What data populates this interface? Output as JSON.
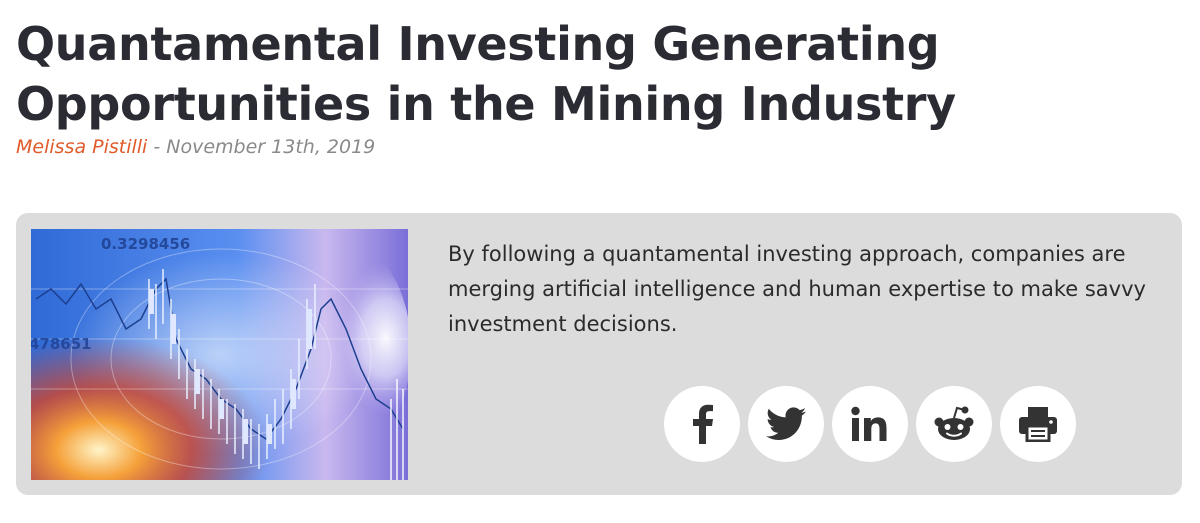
{
  "article": {
    "title_line1": "Quantamental Investing Generating",
    "title_line2": "Opportunities in the Mining Industry",
    "author": "Melissa Pistilli",
    "separator": " - ",
    "date": "November 13th, 2019",
    "summary": "By following a quantamental investing approach, companies are merging artificial intelligence and human expertise to make savvy investment decisions.",
    "image": {
      "icon": "ai-stock-chart-image",
      "number_top": "0.3298456",
      "number_left": "478651"
    }
  },
  "colors": {
    "title": "#2b2c33",
    "author": "#e05a2a",
    "meta": "#8a8a8a",
    "card_background": "#dcdcdc",
    "share_icon": "#333333"
  },
  "share": [
    {
      "name": "facebook",
      "icon": "facebook-icon"
    },
    {
      "name": "twitter",
      "icon": "twitter-icon"
    },
    {
      "name": "linkedin",
      "icon": "linkedin-icon"
    },
    {
      "name": "reddit",
      "icon": "reddit-icon"
    },
    {
      "name": "print",
      "icon": "print-icon"
    }
  ]
}
